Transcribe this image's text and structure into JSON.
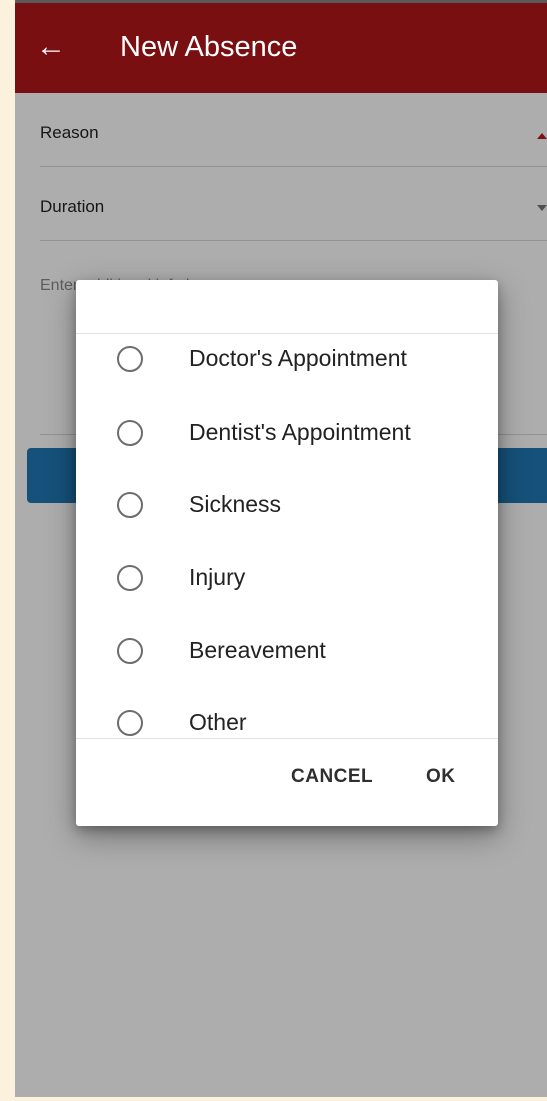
{
  "header": {
    "back_icon": "arrow-left-icon",
    "title": "New Absence",
    "color": "#7a0f12"
  },
  "form": {
    "reason_label": "Reason",
    "duration_label": "Duration",
    "notes_placeholder": "Enter additional info here",
    "accent": "#c0191f",
    "submit_color": "#1f78b4"
  },
  "dialog": {
    "options": [
      "Doctor's Appointment",
      "Dentist's Appointment",
      "Sickness",
      "Injury",
      "Bereavement",
      "Other"
    ],
    "cancel_label": "CANCEL",
    "ok_label": "OK"
  }
}
